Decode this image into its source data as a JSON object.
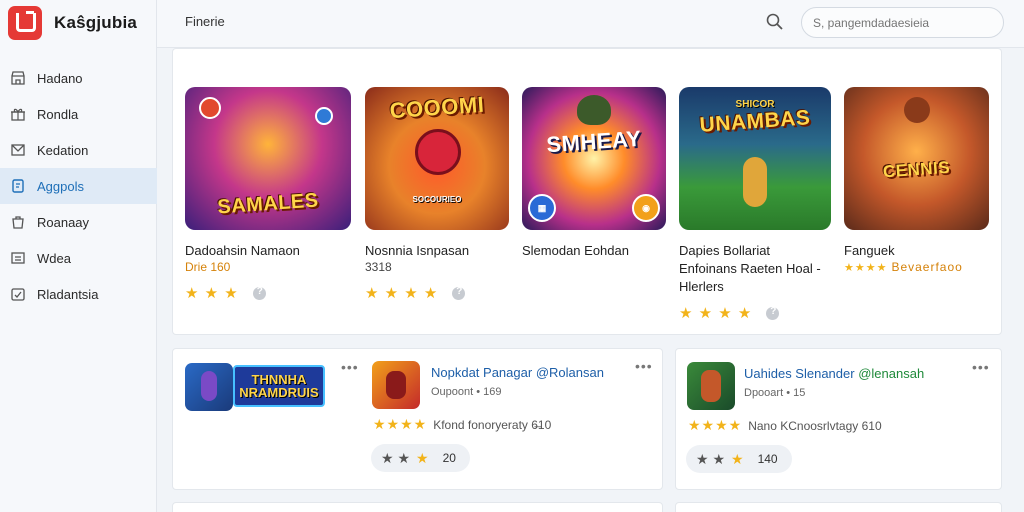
{
  "app": {
    "name": "Kaŝgjubia"
  },
  "sidebar": {
    "items": [
      {
        "label": "Hadano",
        "icon": "store-icon",
        "active": false
      },
      {
        "label": "Rondla",
        "icon": "gift-icon",
        "active": false
      },
      {
        "label": "Kedation",
        "icon": "mail-icon",
        "active": false
      },
      {
        "label": "Aggpols",
        "icon": "apps-icon",
        "active": true
      },
      {
        "label": "Roanaay",
        "icon": "bag-icon",
        "active": false
      },
      {
        "label": "Wdea",
        "icon": "list-icon",
        "active": false
      },
      {
        "label": "Rladantsia",
        "icon": "check-icon",
        "active": false
      }
    ]
  },
  "header": {
    "title": "Finerie",
    "search_placeholder": "S, pangemdadaesieia"
  },
  "featured": [
    {
      "thumb_title": "SAMALES",
      "name": "Dadoahsin Namaon",
      "sub": "Drie 160",
      "rating": 3
    },
    {
      "thumb_title": "COOOMI",
      "thumb_sub": "SOCOURIEO",
      "name": "Nosnnia Isnpasan",
      "sub": "3318",
      "rating": 4
    },
    {
      "thumb_title": "SMHEAY",
      "name": "Slemodan Eohdan",
      "sub": "",
      "rating": 0
    },
    {
      "thumb_title": "UNAMBAS",
      "thumb_pre": "SHICOR",
      "name": "Dapies Bollariat Enfoinans Raeten Hoal - Hlerlers",
      "sub": "",
      "rating": 4
    },
    {
      "thumb_title": "CENNIS",
      "name": "Fanguek",
      "sub": "Bevaerfaoo",
      "rating": 4
    }
  ],
  "cards": [
    {
      "wide_logo": "THNNHA NRAMDRUIS"
    },
    {
      "title": "Nopkdat Panagar",
      "title_tag": "@Rolansan",
      "sub": "Oupoont • 169",
      "rating_text": "Kfond fonoryeraty 6̶10",
      "pill_value": "20"
    },
    {
      "title": "Uahides Slenander",
      "title_tag": "@lenansah",
      "sub": "Dpooart • 15",
      "rating_text": "Nano KCnoosrlvtagy 610",
      "pill_value": "140"
    }
  ],
  "colors": {
    "accent": "#1e6fb8",
    "brand": "#e53935",
    "star": "#f2b31a",
    "active_bg": "#dfeaf6"
  }
}
